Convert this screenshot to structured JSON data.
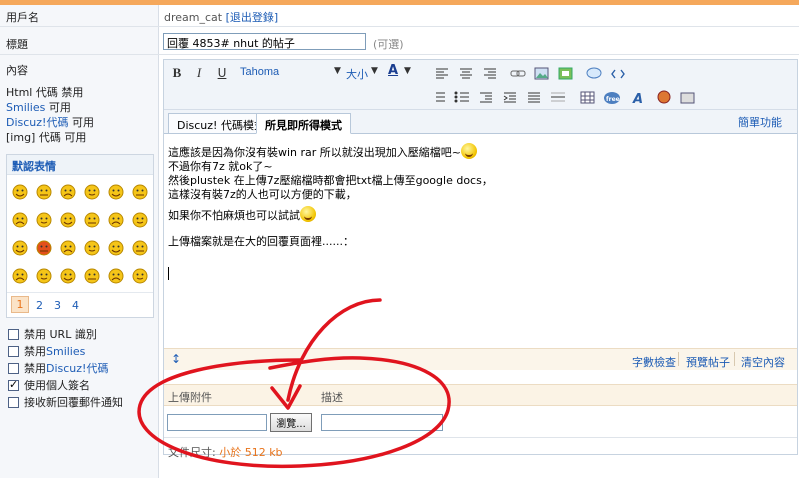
{
  "form": {
    "username_label": "用戶名",
    "username": "dream_cat",
    "logout_link": "[退出登錄]",
    "title_label": "標題",
    "title_value": "回覆 4853#  nhut 的帖子",
    "title_optional": "(可選)",
    "content_label": "內容"
  },
  "codes": {
    "html_line": "Html 代碼 禁用",
    "smilies_link": "Smilies",
    "smilies_status": " 可用",
    "discuz_link": "Discuz!代碼",
    "discuz_status": " 可用",
    "img_line": "[img] 代碼 可用"
  },
  "smilies_panel": {
    "title": "默認表情",
    "pages": [
      "1",
      "2",
      "3",
      "4"
    ],
    "count": 24
  },
  "options": [
    {
      "label": "禁用 URL 識別",
      "checked": false
    },
    {
      "label": "禁用 ",
      "link": "Smilies",
      "checked": false
    },
    {
      "label": "禁用 ",
      "link": "Discuz!代碼",
      "checked": false
    },
    {
      "label": "使用個人簽名",
      "checked": true
    },
    {
      "label": "接收新回覆郵件通知",
      "checked": false
    }
  ],
  "toolbar": {
    "font_name": "Tahoma",
    "font_size": "大小",
    "bold": "B",
    "italic": "I",
    "underline": "U",
    "text_color": "A"
  },
  "tabs": {
    "code_mode": "Discuz! 代碼模式",
    "wysiwyg_mode": "所見即所得模式",
    "simple_features": "簡單功能"
  },
  "content": {
    "lines": [
      "這應該是因為你沒有裝win rar 所以就沒出現加入壓縮檔吧~",
      "不過你有7z 就ok了~",
      "然後plustek 在上傳7z壓縮檔時都會把txt檔上傳至google docs，",
      "這樣沒有裝7z的人也可以方便的下載，",
      "如果你不怕麻煩也可以試試",
      "上傳檔案就是在大的回覆頁面裡......："
    ]
  },
  "editor_bottom": {
    "word_count": "字數檢查",
    "preview": "預覽帖子",
    "clear": "清空內容"
  },
  "attachments": {
    "upload_label": "上傳附件",
    "desc_label": "描述",
    "browse_button": "瀏覽...",
    "size_label": "文件尺寸: ",
    "size_value": "小於 512 kb"
  },
  "colors": {
    "accent_orange": "#f5a85b",
    "link_blue": "#1d5cb5",
    "annotation_red": "#e0141e"
  }
}
